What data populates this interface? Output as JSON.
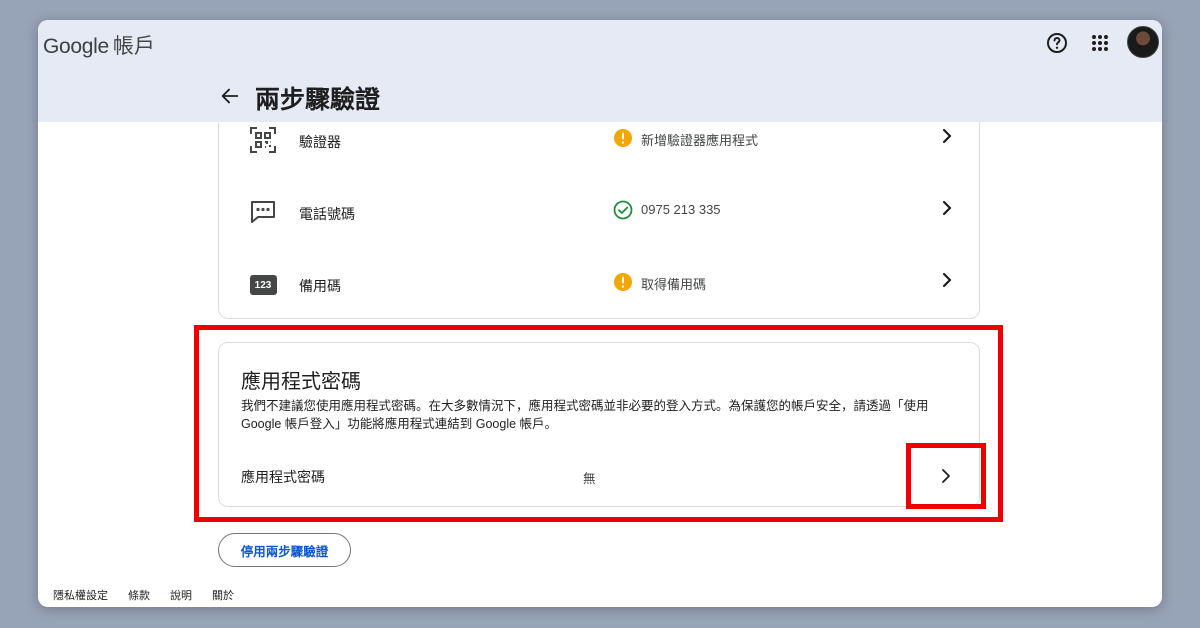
{
  "header": {
    "brand_google": "Google",
    "brand_account": "帳戶",
    "page_title": "兩步驟驗證"
  },
  "methods": [
    {
      "label": "驗證器",
      "status": "新增驗證器應用程式",
      "status_type": "warning",
      "icon": "qr-code-icon"
    },
    {
      "label": "電話號碼",
      "status": "0975 213 335",
      "status_type": "ok",
      "icon": "message-icon"
    },
    {
      "label": "備用碼",
      "badge": "123",
      "status": "取得備用碼",
      "status_type": "warning",
      "icon": "backup-code-icon"
    }
  ],
  "app_passwords": {
    "title": "應用程式密碼",
    "description": "我們不建議您使用應用程式密碼。在大多數情況下，應用程式密碼並非必要的登入方式。為保護您的帳戶安全，請透過「使用 Google 帳戶登入」功能將應用程式連結到 Google 帳戶。",
    "row_label": "應用程式密碼",
    "row_value": "無"
  },
  "disable_button": "停用兩步驟驗證",
  "footer": {
    "privacy": "隱私權設定",
    "terms": "條款",
    "help": "說明",
    "about": "關於"
  },
  "colors": {
    "accent": "#0b57d0",
    "warning": "#f2a600",
    "success": "#1e8e3e",
    "highlight": "#ee0000",
    "header_bg": "#e6eaf5",
    "page_bg": "#97a3b6"
  }
}
